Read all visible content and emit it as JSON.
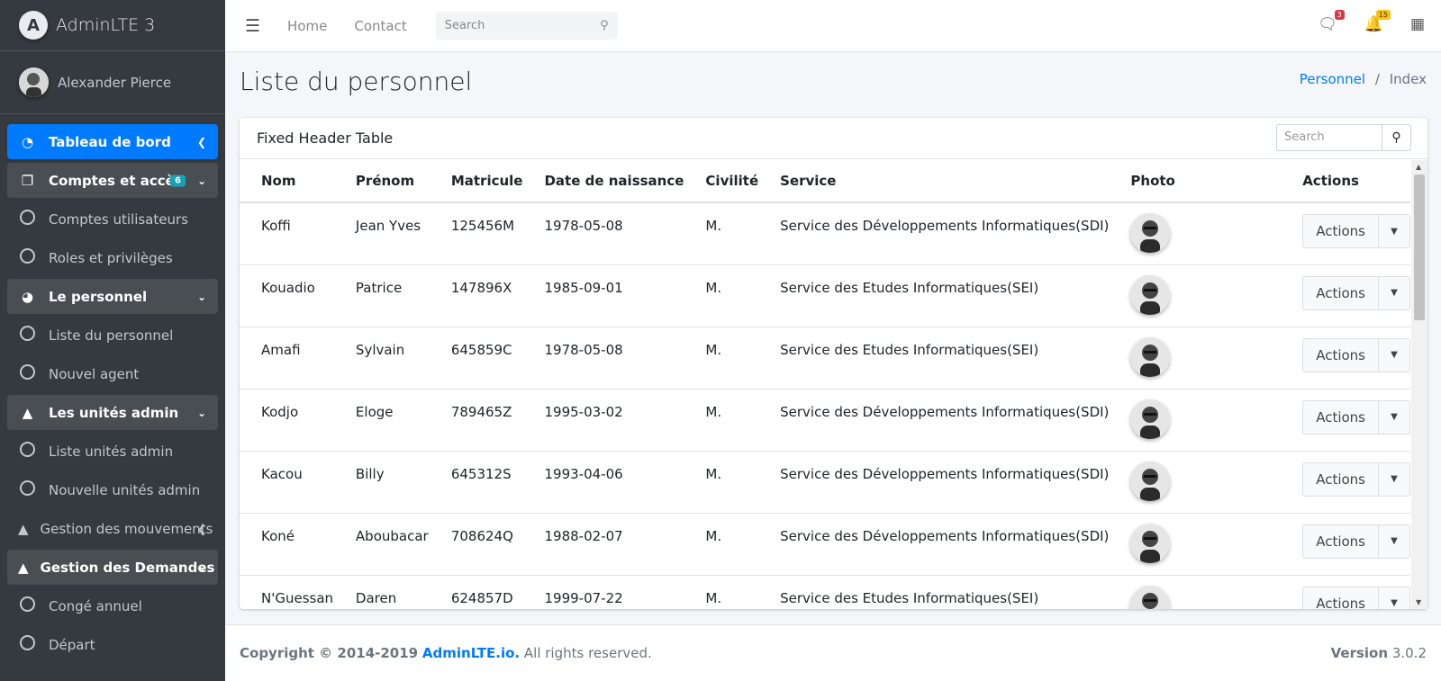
{
  "brand": {
    "logo_letter": "A",
    "name": "AdminLTE 3"
  },
  "user": {
    "name": "Alexander Pierce"
  },
  "sidebar": {
    "items": [
      {
        "label": "Tableau de bord"
      },
      {
        "label": "Comptes et accès",
        "badge": "6"
      },
      {
        "label": "Comptes utilisateurs"
      },
      {
        "label": "Roles et privilèges"
      },
      {
        "label": "Le personnel"
      },
      {
        "label": "Liste du personnel"
      },
      {
        "label": "Nouvel agent"
      },
      {
        "label": "Les unités admin"
      },
      {
        "label": "Liste unités admin"
      },
      {
        "label": "Nouvelle unités admin"
      },
      {
        "label": "Gestion des mouvements"
      },
      {
        "label": "Gestion des Demandes"
      },
      {
        "label": "Congé annuel"
      },
      {
        "label": "Départ"
      }
    ]
  },
  "topnav": {
    "home": "Home",
    "contact": "Contact",
    "search_placeholder": "Search",
    "messages_count": "3",
    "notifications_count": "15"
  },
  "page": {
    "title": "Liste du personnel"
  },
  "breadcrumb": {
    "parent": "Personnel",
    "separator": "/",
    "current": "Index"
  },
  "card": {
    "title": "Fixed Header Table",
    "search_placeholder": "Search"
  },
  "table": {
    "headers": [
      "Nom",
      "Prénom",
      "Matricule",
      "Date de naissance",
      "Civilité",
      "Service",
      "Photo",
      "Actions"
    ],
    "rows": [
      {
        "nom": "Koffi",
        "prenom": "Jean Yves",
        "matricule": "125456M",
        "naissance": "1978-05-08",
        "civilite": "M.",
        "service": "Service des Développements Informatiques(SDI)",
        "action": "Actions"
      },
      {
        "nom": "Kouadio",
        "prenom": "Patrice",
        "matricule": "147896X",
        "naissance": "1985-09-01",
        "civilite": "M.",
        "service": "Service des Etudes Informatiques(SEI)",
        "action": "Actions"
      },
      {
        "nom": "Amafi",
        "prenom": "Sylvain",
        "matricule": "645859C",
        "naissance": "1978-05-08",
        "civilite": "M.",
        "service": "Service des Etudes Informatiques(SEI)",
        "action": "Actions"
      },
      {
        "nom": "Kodjo",
        "prenom": "Eloge",
        "matricule": "789465Z",
        "naissance": "1995-03-02",
        "civilite": "M.",
        "service": "Service des Développements Informatiques(SDI)",
        "action": "Actions"
      },
      {
        "nom": "Kacou",
        "prenom": "Billy",
        "matricule": "645312S",
        "naissance": "1993-04-06",
        "civilite": "M.",
        "service": "Service des Développements Informatiques(SDI)",
        "action": "Actions"
      },
      {
        "nom": "Koné",
        "prenom": "Aboubacar",
        "matricule": "708624Q",
        "naissance": "1988-02-07",
        "civilite": "M.",
        "service": "Service des Développements Informatiques(SDI)",
        "action": "Actions"
      },
      {
        "nom": "N'Guessan",
        "prenom": "Daren",
        "matricule": "624857D",
        "naissance": "1999-07-22",
        "civilite": "M.",
        "service": "Service des Etudes Informatiques(SEI)",
        "action": "Actions"
      }
    ]
  },
  "footer": {
    "copyright": "Copyright © 2014-2019",
    "link": "AdminLTE.io.",
    "rights": "All rights reserved.",
    "version_label": "Version",
    "version": "3.0.2"
  }
}
